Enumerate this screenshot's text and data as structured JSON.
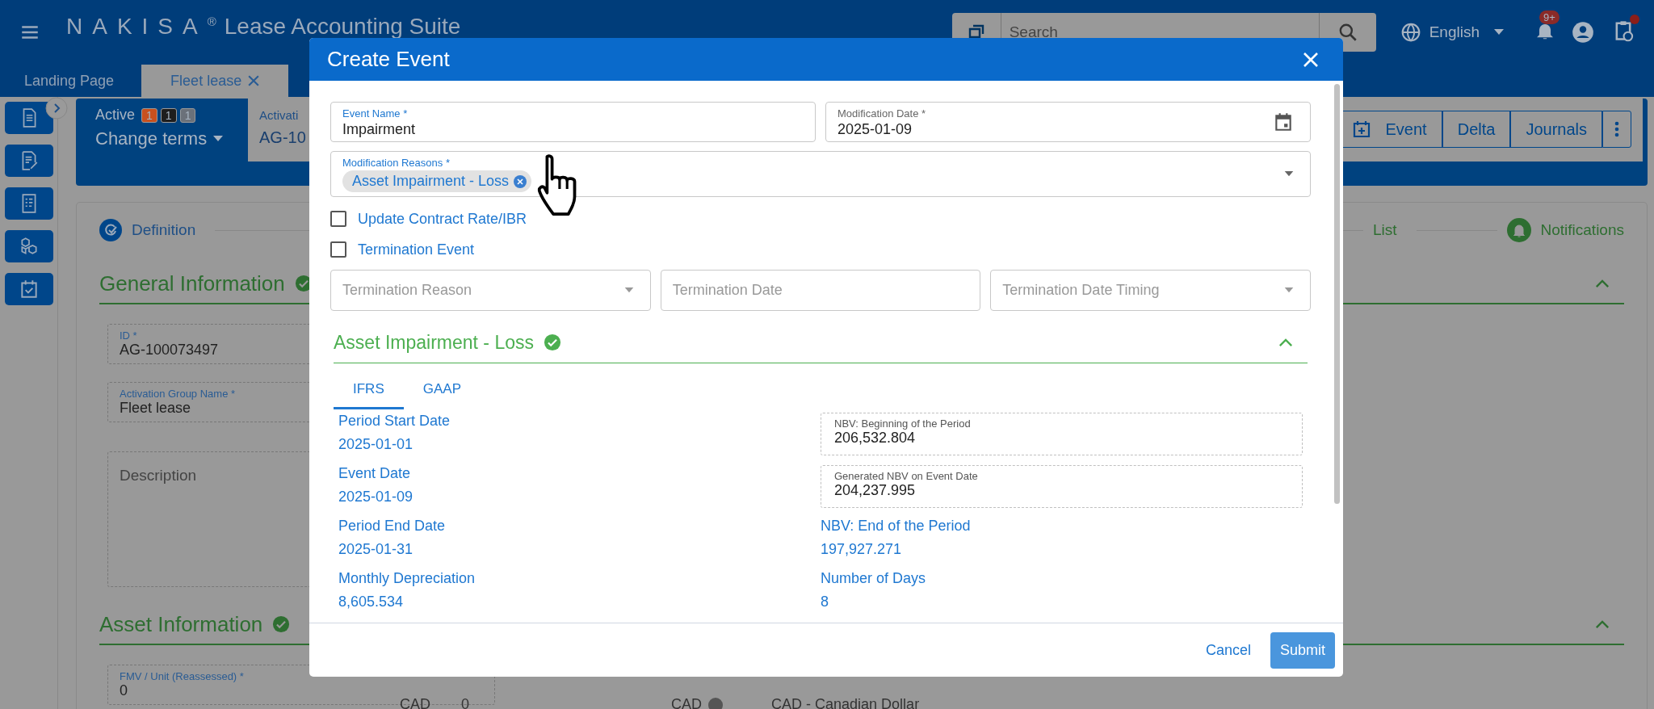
{
  "header": {
    "brand": "NAKISA",
    "registered": "®",
    "product": "Lease Accounting Suite",
    "search": {
      "placeholder": "Search"
    },
    "language": "English",
    "notification_badge": "9+",
    "tasks_alert": true
  },
  "tabs": [
    {
      "label": "Landing Page",
      "selected": false,
      "closable": false
    },
    {
      "label": "Fleet lease",
      "selected": true,
      "closable": true
    }
  ],
  "record": {
    "status": "Active",
    "counts": [
      {
        "value": "1",
        "color": "#c8501e"
      },
      {
        "value": "1",
        "color": "#1e1e1e"
      },
      {
        "value": "1",
        "color": "#6b717a"
      }
    ],
    "action": "Change terms",
    "field_label": "Activati",
    "field_value": "AG-10",
    "buttons": [
      {
        "label": "Event",
        "kind": "icon-label"
      },
      {
        "label": "Delta",
        "kind": "label"
      },
      {
        "label": "Journals",
        "kind": "label"
      },
      {
        "kind": "more"
      }
    ]
  },
  "stepper": [
    {
      "label": "Definition",
      "kind": "definition"
    },
    {
      "label": "List",
      "kind": "plain"
    },
    {
      "label": "Notifications",
      "kind": "bell"
    }
  ],
  "sections": [
    {
      "title": "General Information",
      "complete": true,
      "expanded": true,
      "fields": [
        {
          "label": "ID *",
          "value": "AG-100073497",
          "kind": "input"
        },
        {
          "label": "Activation Group Name *",
          "value": "Fleet lease",
          "kind": "input"
        },
        {
          "placeholder": "Description",
          "kind": "textarea"
        }
      ]
    },
    {
      "title": "Asset Information",
      "complete": true,
      "expanded": true,
      "fields": [
        {
          "label": "FMV / Unit (Reassessed) *",
          "value": "0",
          "kind": "input"
        }
      ]
    }
  ],
  "bottom_row": [
    {
      "text": "CAD",
      "kind": "unit"
    },
    {
      "text": "0",
      "kind": "value"
    },
    {
      "text": "CAD",
      "kind": "unit-info"
    },
    {
      "text": "CAD - Canadian Dollar",
      "kind": "value"
    }
  ],
  "modal": {
    "title": "Create Event",
    "event_name": {
      "label": "Event Name *",
      "value": "Impairment"
    },
    "modification_date": {
      "label": "Modification Date *",
      "value": "2025-01-09"
    },
    "modification_reasons": {
      "label": "Modification Reasons *",
      "chips": [
        "Asset Impairment - Loss"
      ]
    },
    "checkboxes": [
      {
        "label": "Update Contract Rate/IBR",
        "checked": false
      },
      {
        "label": "Termination Event",
        "checked": false
      }
    ],
    "termination_fields": [
      {
        "placeholder": "Termination Reason",
        "kind": "select"
      },
      {
        "placeholder": "Termination Date",
        "kind": "date"
      },
      {
        "placeholder": "Termination Date Timing",
        "kind": "select"
      }
    ],
    "section": {
      "title": "Asset Impairment - Loss",
      "complete": true,
      "expanded": true
    },
    "subtabs": [
      {
        "label": "IFRS",
        "selected": true
      },
      {
        "label": "GAAP",
        "selected": false
      }
    ],
    "left_items": [
      {
        "label": "Period Start Date",
        "value": "2025-01-01"
      },
      {
        "label": "Event Date",
        "value": "2025-01-09"
      },
      {
        "label": "Period End Date",
        "value": "2025-01-31"
      },
      {
        "label": "Monthly Depreciation",
        "value": "8,605.534"
      }
    ],
    "right_items": [
      {
        "label": "NBV: Beginning of the Period",
        "value": "206,532.804",
        "kind": "readonly-field"
      },
      {
        "label": "Generated NBV on Event Date",
        "value": "204,237.995",
        "kind": "readonly-field"
      },
      {
        "label": "NBV: End of the Period",
        "value": "197,927.271",
        "kind": "text"
      },
      {
        "label": "Number of Days",
        "value": "8",
        "kind": "text"
      }
    ],
    "buttons": [
      {
        "label": "Cancel",
        "kind": "link"
      },
      {
        "label": "Submit",
        "kind": "primary"
      }
    ]
  }
}
